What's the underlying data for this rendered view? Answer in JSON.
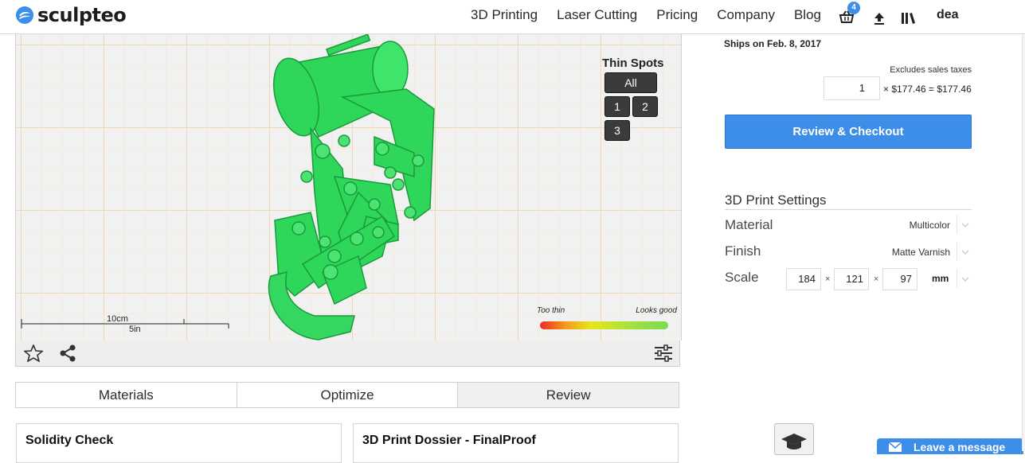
{
  "brand": {
    "name": "sculpteo",
    "accent": "#3d8ee8"
  },
  "nav": {
    "items": [
      "3D Printing",
      "Laser Cutting",
      "Pricing",
      "Company",
      "Blog"
    ]
  },
  "header": {
    "cart_count": "4",
    "cart_icon": "basket-icon",
    "upload_icon": "upload-icon",
    "library_icon": "library-icon",
    "user": "dea"
  },
  "viewer": {
    "model_color": "#2ed65a",
    "thin_spots": {
      "title": "Thin Spots",
      "buttons": [
        "All",
        "1",
        "2",
        "3"
      ]
    },
    "scale_bar": {
      "metric": "10cm",
      "imperial": "5in"
    },
    "thickness_legend": {
      "min_label": "Too thin",
      "max_label": "Looks good"
    },
    "toolbar": {
      "favorite_icon": "star-icon",
      "share_icon": "share-icon",
      "settings_icon": "sliders-icon"
    }
  },
  "tabs": [
    "Materials",
    "Optimize",
    "Review"
  ],
  "cards": {
    "left_title": "Solidity Check",
    "right_title": "3D Print Dossier - FinalProof"
  },
  "order": {
    "ships": "Ships on Feb. 8, 2017",
    "tax_note": "Excludes sales taxes",
    "quantity": "1",
    "price_line": "× $177.46 = $177.46",
    "checkout_label": "Review & Checkout"
  },
  "settings": {
    "title": "3D Print Settings",
    "material_label": "Material",
    "material_value": "Multicolor",
    "finish_label": "Finish",
    "finish_value": "Matte Varnish",
    "scale_label": "Scale",
    "dims": [
      "184",
      "121",
      "97"
    ],
    "times": "×",
    "unit": "mm"
  },
  "chat": {
    "label": "Leave a message",
    "icon": "mail-icon"
  },
  "help_icon": "graduation-cap-icon"
}
